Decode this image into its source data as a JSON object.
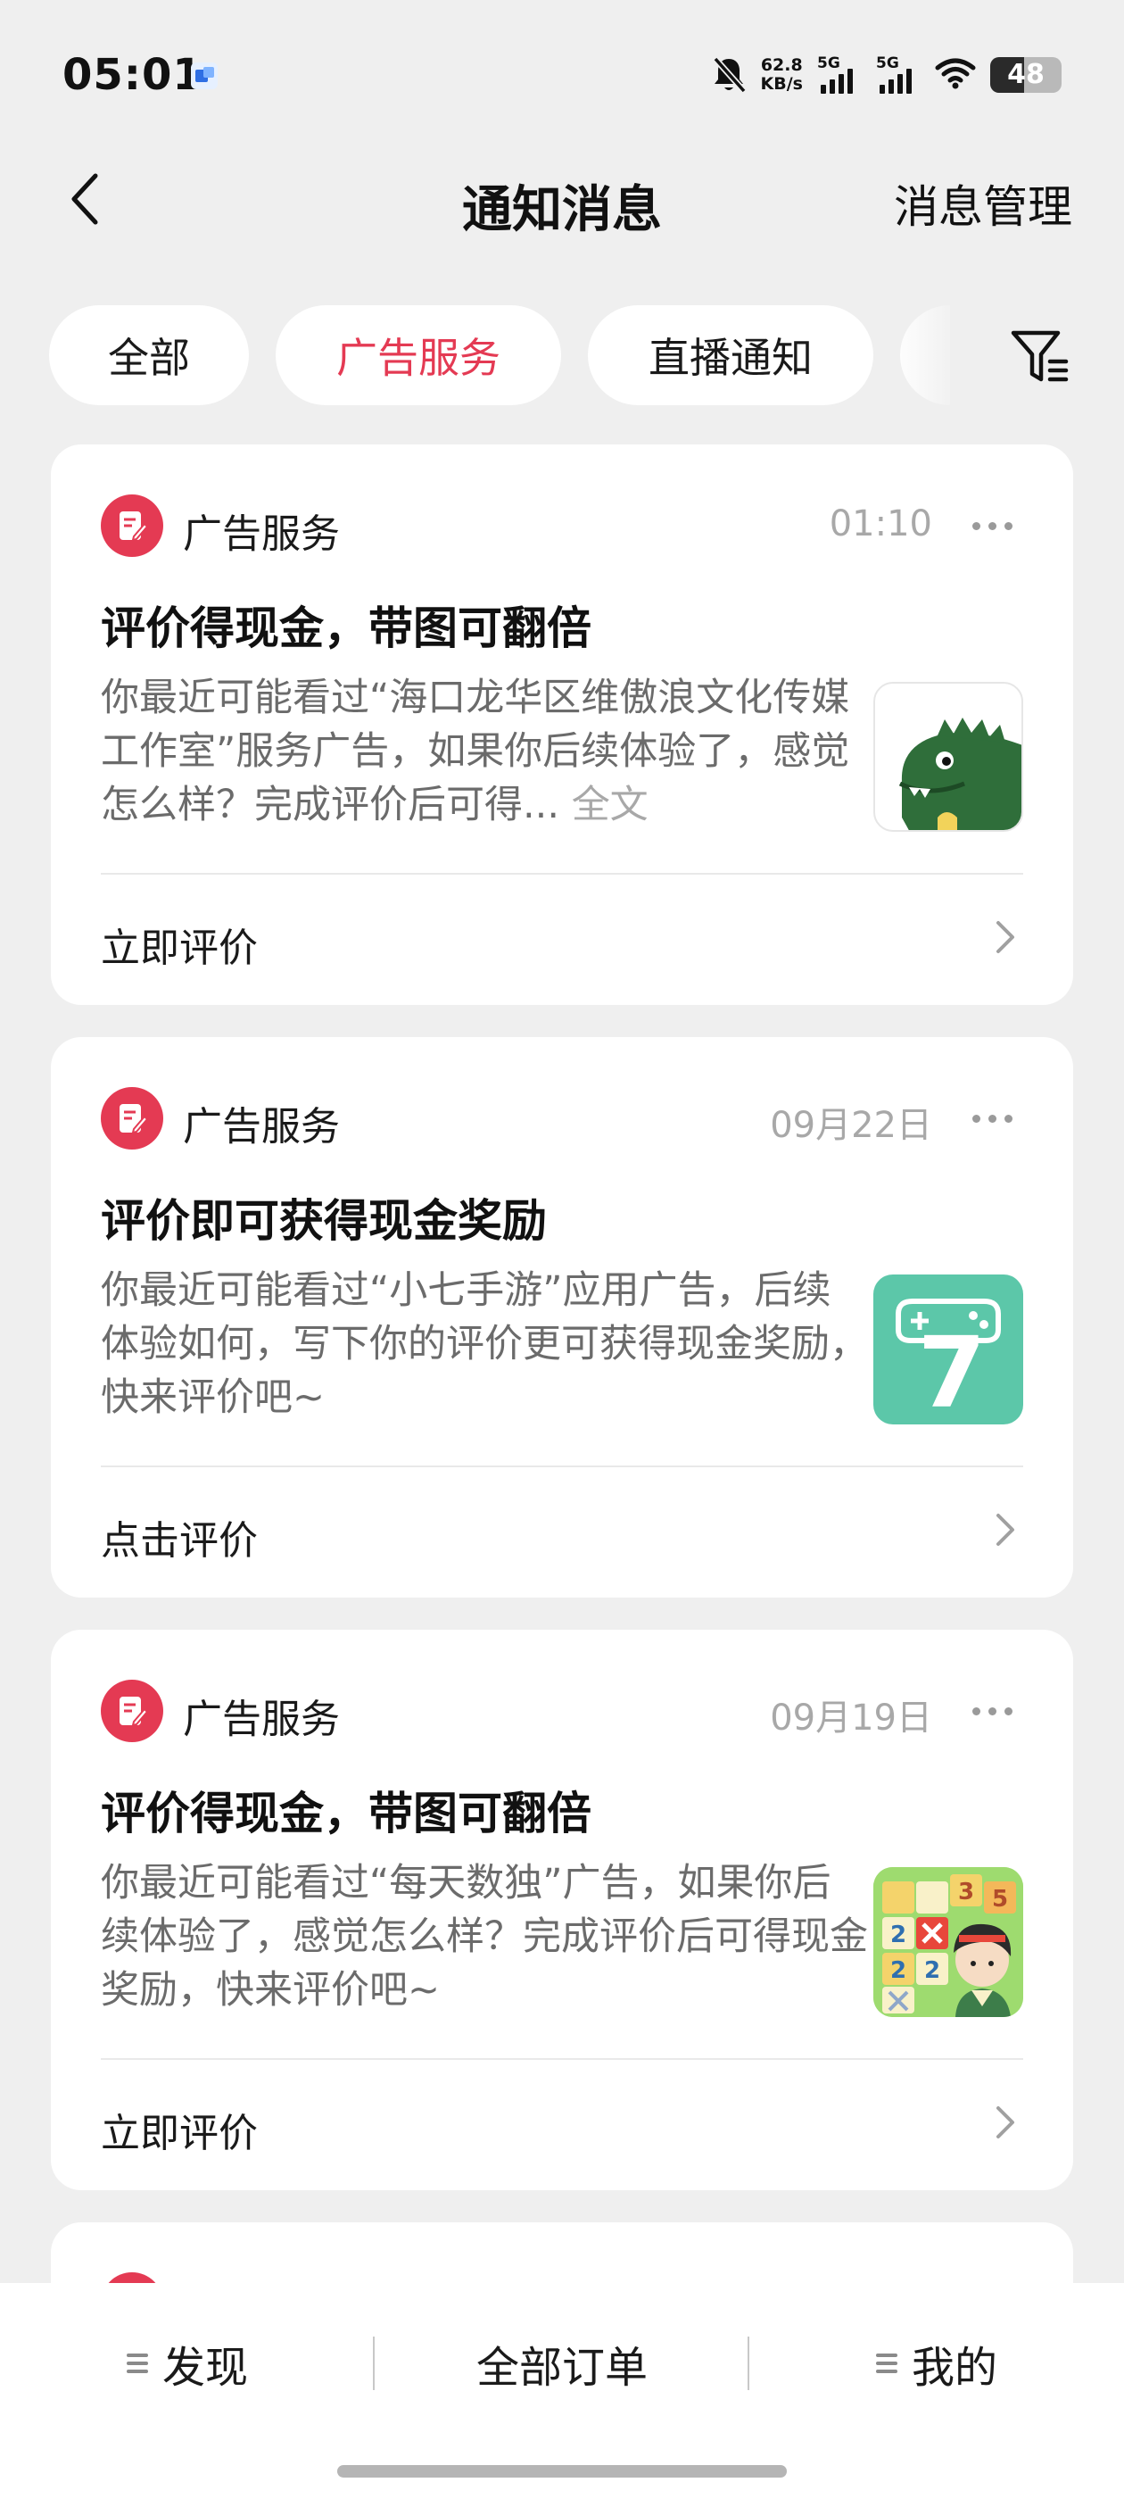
{
  "status_bar": {
    "time": "05:01",
    "net_speed_value": "62.8",
    "net_speed_unit": "KB/s",
    "signal1_label": "5G",
    "signal2_label": "5G",
    "battery": "48"
  },
  "header": {
    "title": "通知消息",
    "manage_label": "消息管理"
  },
  "tabs": [
    {
      "label": "全部",
      "active": false
    },
    {
      "label": "广告服务",
      "active": true
    },
    {
      "label": "直播通知",
      "active": false
    }
  ],
  "notifications": [
    {
      "source": "广告服务",
      "time": "01:10",
      "title": "评价得现金，带图可翻倍",
      "body": "你最近可能看过“海口龙华区维傲浪文化传媒工作室”服务广告，如果你后续体验了，感觉怎么样？完成评价后可得...",
      "full_text_label": "全文",
      "thumbnail": "dinosaur-icon",
      "action_label": "立即评价"
    },
    {
      "source": "广告服务",
      "time": "09月22日",
      "title": "评价即可获得现金奖励",
      "body": "你最近可能看过“小七手游”应用广告，后续体验如何，写下你的评价更可获得现金奖励，快来评价吧~",
      "full_text_label": "",
      "thumbnail": "xiaoqi-game-7-icon",
      "thumb_number": "7",
      "action_label": "点击评价"
    },
    {
      "source": "广告服务",
      "time": "09月19日",
      "title": "评价得现金，带图可翻倍",
      "body": "你最近可能看过“每天数独”广告，如果你后续体验了，感觉怎么样？完成评价后可得现金奖励，快来评价吧~",
      "full_text_label": "",
      "thumbnail": "sudoku-game-icon",
      "sudoku_digits": [
        "3",
        "5",
        "2",
        "2",
        "2"
      ],
      "action_label": "立即评价"
    }
  ],
  "bottom_nav": {
    "discover": "发现",
    "orders": "全部订单",
    "mine": "我的"
  },
  "colors": {
    "accent": "#e43a53",
    "background": "#efefef",
    "card": "#ffffff",
    "muted_text": "#6b6b6b"
  }
}
